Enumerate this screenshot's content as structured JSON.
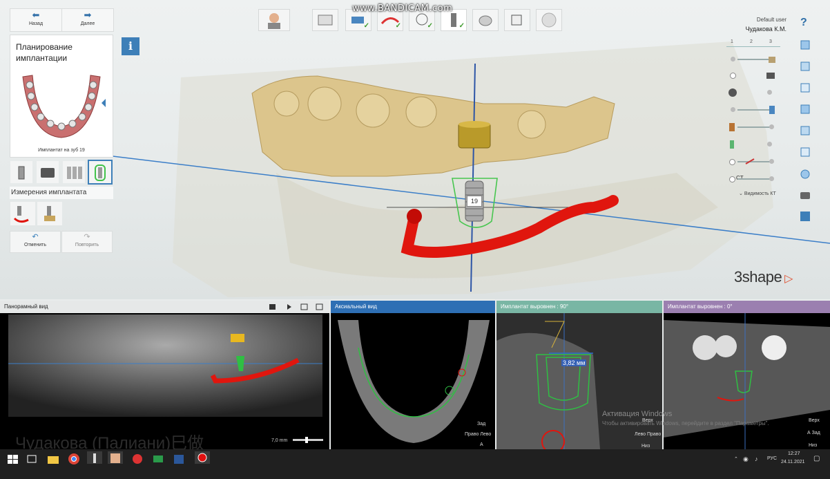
{
  "window_watermark": "www.BANDICAM.com",
  "nav": {
    "back_label": "Назад",
    "next_label": "Далее"
  },
  "plan_card": {
    "title": "Планирование имплантации",
    "subtitle": "Имплантат на зуб 19"
  },
  "measurements_label": "Измерения имплантата",
  "undo_label": "Отменить",
  "redo_label": "Повторить",
  "user": {
    "role": "Default user",
    "name": "Чудакова К.М."
  },
  "right_tabs": [
    "1",
    "2",
    "3"
  ],
  "visibility_ct_label": "Видимость КТ",
  "slider_ct_label": "CT",
  "implant_tag": "19",
  "logo": "3shape",
  "workflow_steps": [
    {
      "icon": "patient-icon",
      "done": false
    },
    {
      "icon": "scan-icon",
      "done": true
    },
    {
      "icon": "segmentation-icon",
      "done": true
    },
    {
      "icon": "nerve-icon",
      "done": true
    },
    {
      "icon": "implant-icon",
      "done": true
    },
    {
      "icon": "sleeve-icon",
      "done": false
    },
    {
      "icon": "guide-icon",
      "done": false
    },
    {
      "icon": "export-icon",
      "done": false
    }
  ],
  "panels": {
    "panoramic": {
      "title": "Панорамный вид",
      "overlay_text": "Чудакова (Палиани)巳做",
      "slice": "7,0 mm"
    },
    "axial": {
      "title": "Аксиальный вид",
      "orient_top": "Зад",
      "orient_side": "Право Лево",
      "orient_bottom": "A"
    },
    "aligned90": {
      "title": "Имплантат выровнен : 90°",
      "measurement": "3,82 мм",
      "orient_top": "Верх",
      "orient_side": "Лево Право",
      "orient_bottom": "Низ"
    },
    "aligned0": {
      "title": "Имплантат выровнен : 0°",
      "orient_top": "Верх",
      "orient_side": "А Зад",
      "orient_bottom": "Низ"
    }
  },
  "windows_activation": {
    "line1": "Активация Windows",
    "line2": "Чтобы активировать Windows, перейдите в раздел \"Параметры\"."
  },
  "taskbar": {
    "lang": "РУС",
    "time": "12:27",
    "date": "24.11.2021"
  },
  "colors": {
    "accent": "#3d7fb8",
    "nerve": "#e0160e",
    "implant_guide": "#42c24a",
    "panel_blue": "#2e6fb4",
    "panel_teal": "#79b6a4",
    "panel_purple": "#9b7fb0"
  }
}
